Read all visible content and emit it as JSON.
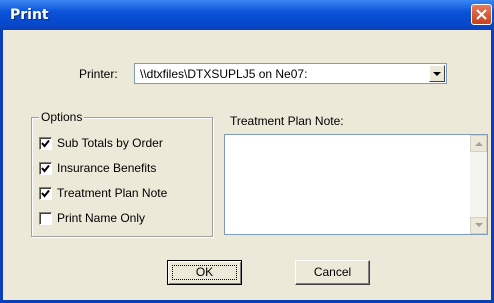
{
  "window": {
    "title": "Print"
  },
  "printer": {
    "label": "Printer:",
    "value": "\\\\dtxfiles\\DTXSUPLJ5 on Ne07:"
  },
  "options": {
    "group_label": "Options",
    "items": [
      {
        "label": "Sub Totals by Order",
        "checked": true
      },
      {
        "label": "Insurance Benefits",
        "checked": true
      },
      {
        "label": "Treatment Plan Note",
        "checked": true
      },
      {
        "label": "Print Name Only",
        "checked": false
      }
    ]
  },
  "note": {
    "label": "Treatment Plan Note:",
    "value": ""
  },
  "buttons": {
    "ok": "OK",
    "cancel": "Cancel"
  }
}
